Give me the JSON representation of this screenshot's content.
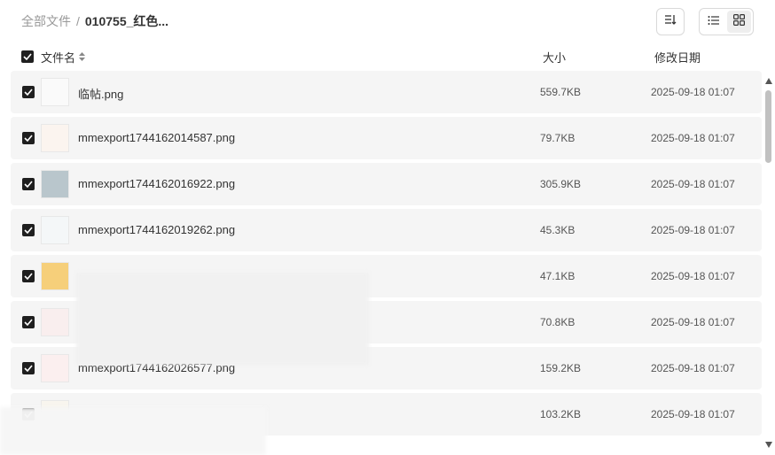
{
  "breadcrumb": {
    "root": "全部文件",
    "separator": "/",
    "current": "010755_红色..."
  },
  "toolbar": {
    "sort_icon": "sort-icon",
    "list_view_icon": "list-view-icon",
    "grid_view_icon": "grid-view-icon",
    "active_view": "grid"
  },
  "table": {
    "columns": {
      "name": "文件名",
      "size": "大小",
      "date": "修改日期"
    },
    "rows": [
      {
        "name": "临帖.png",
        "size": "559.7KB",
        "date": "2025-09-18 01:07",
        "checked": true,
        "thumb_color": "#fafafa"
      },
      {
        "name": "mmexport1744162014587.png",
        "size": "79.7KB",
        "date": "2025-09-18 01:07",
        "checked": true,
        "thumb_color": "#fbf4ef"
      },
      {
        "name": "mmexport1744162016922.png",
        "size": "305.9KB",
        "date": "2025-09-18 01:07",
        "checked": true,
        "thumb_color": "#b9c6cc"
      },
      {
        "name": "mmexport1744162019262.png",
        "size": "45.3KB",
        "date": "2025-09-18 01:07",
        "checked": true,
        "thumb_color": "#f4f7f8"
      },
      {
        "name": "",
        "size": "47.1KB",
        "date": "2025-09-18 01:07",
        "checked": true,
        "thumb_color": "#f6cf7a"
      },
      {
        "name": "",
        "size": "70.8KB",
        "date": "2025-09-18 01:07",
        "checked": true,
        "thumb_color": "#f9eeee"
      },
      {
        "name": "mmexport1744162026577.png",
        "size": "159.2KB",
        "date": "2025-09-18 01:07",
        "checked": true,
        "thumb_color": "#fbefef"
      },
      {
        "name": "",
        "size": "103.2KB",
        "date": "2025-09-18 01:07",
        "checked": true,
        "thumb_color": "#f8f5ee"
      }
    ]
  }
}
